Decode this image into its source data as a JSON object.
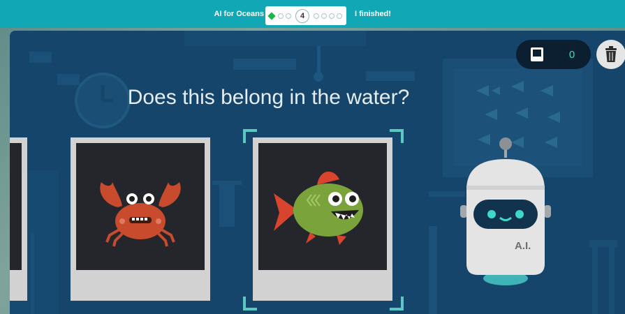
{
  "header": {
    "course_title": "AI for Oceans",
    "current_step": "4",
    "finish_label": "I finished!"
  },
  "counter": {
    "value": "0",
    "icon": "card-icon"
  },
  "trash": {
    "icon": "trash-icon"
  },
  "question": "Does this belong in the water?",
  "cards": [
    {
      "subject": "crab",
      "icon": "crab-icon"
    },
    {
      "subject": "fish",
      "icon": "fish-icon",
      "selected": true
    }
  ],
  "robot": {
    "badge": "A.I.",
    "icon": "robot-icon"
  },
  "colors": {
    "header": "#11a7b5",
    "stage": "#15456b",
    "crab": "#c84b2e",
    "fish": "#7aa33c",
    "fin": "#d9442f",
    "robot_eyes": "#3fd8c8",
    "bracket": "#5bc9c2"
  }
}
